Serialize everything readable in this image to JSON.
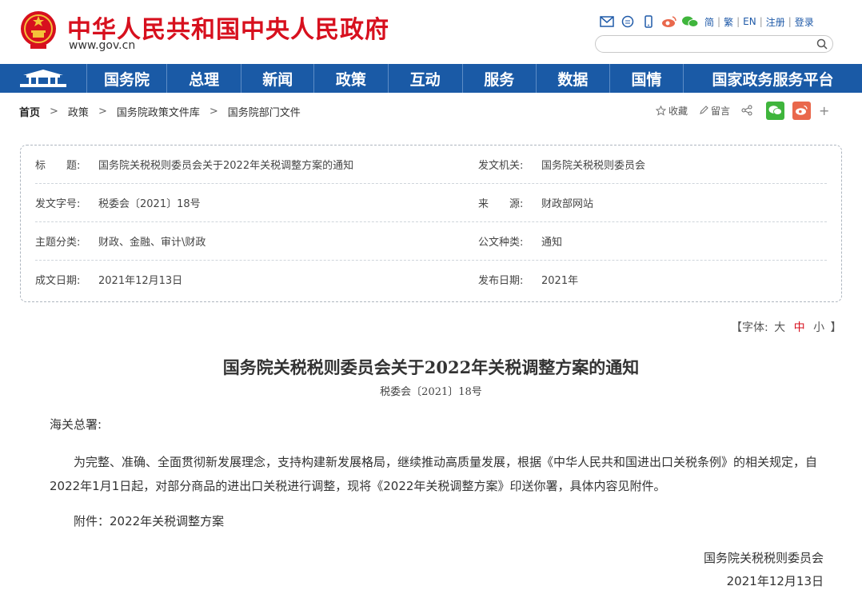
{
  "header": {
    "site_title": "中华人民共和国中央人民政府",
    "site_url": "www.gov.cn",
    "links": [
      "简",
      "繁",
      "EN",
      "注册",
      "登录"
    ],
    "search_placeholder": ""
  },
  "nav": {
    "items": [
      "国务院",
      "总理",
      "新闻",
      "政策",
      "互动",
      "服务",
      "数据",
      "国情",
      "国家政务服务平台"
    ]
  },
  "breadcrumb": [
    "首页",
    "政策",
    "国务院政策文件库",
    "国务院部门文件"
  ],
  "tools": {
    "favorite": "收藏",
    "comment": "留言",
    "more": "+"
  },
  "info": {
    "rows": [
      {
        "l_label": "标　　题:",
        "l_value": "国务院关税税则委员会关于2022年关税调整方案的通知",
        "r_label": "发文机关:",
        "r_value": "国务院关税税则委员会"
      },
      {
        "l_label": "发文字号:",
        "l_value": "税委会〔2021〕18号",
        "r_label": "来　　源:",
        "r_value": "财政部网站"
      },
      {
        "l_label": "主题分类:",
        "l_value": "财政、金融、审计\\财政",
        "r_label": "公文种类:",
        "r_value": "通知"
      },
      {
        "l_label": "成文日期:",
        "l_value": "2021年12月13日",
        "r_label": "发布日期:",
        "r_value": "2021年"
      }
    ]
  },
  "font_switch": {
    "open": "【字体:",
    "large": "大",
    "medium": "中",
    "small": "小",
    "close": "】"
  },
  "article": {
    "title": "国务院关税税则委员会关于2022年关税调整方案的通知",
    "doc_no": "税委会〔2021〕18号",
    "salutation": "海关总署:",
    "body": "为完整、准确、全面贯彻新发展理念，支持构建新发展格局，继续推动高质量发展，根据《中华人民共和国进出口关税条例》的相关规定，自2022年1月1日起，对部分商品的进出口关税进行调整，现将《2022年关税调整方案》印送你署，具体内容见附件。",
    "attachment": "附件：2022年关税调整方案",
    "signature": "国务院关税税则委员会",
    "date": "2021年12月13日"
  },
  "colors": {
    "brand_red": "#d7101e",
    "nav_blue": "#1a5aa6",
    "wechat_green": "#3fb53c",
    "weibo_orange": "#e9684c"
  }
}
